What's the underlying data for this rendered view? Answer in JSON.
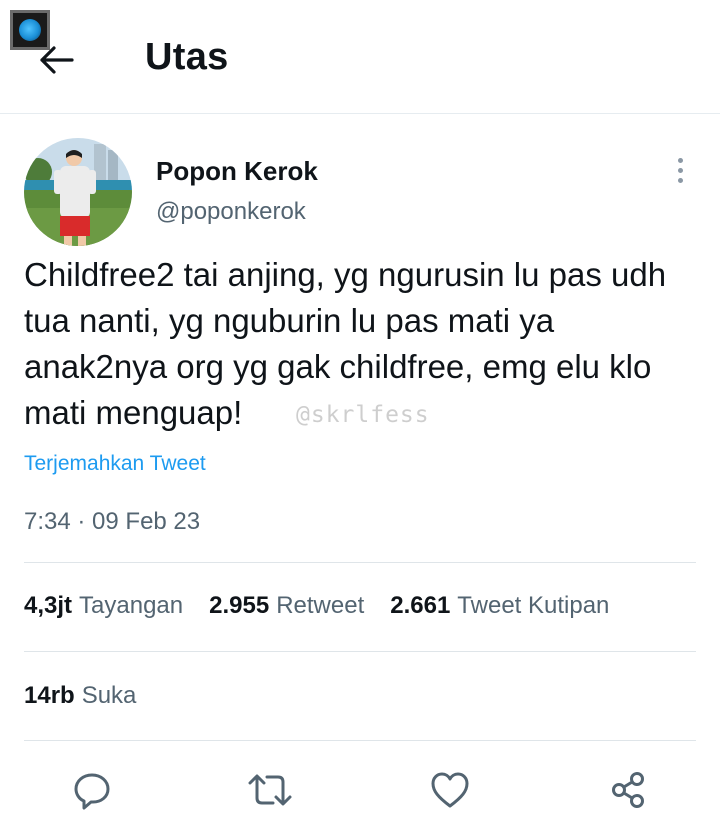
{
  "header": {
    "title": "Utas",
    "back_icon": "arrow-left-icon"
  },
  "tweet": {
    "author_name": "Popon Kerok",
    "author_handle": "@poponkerok",
    "text": "Childfree2 tai anjing, yg ngurusin lu pas udh tua nanti, yg nguburin lu pas mati ya anak2nya org yg gak childfree, emg elu klo mati menguap!",
    "watermark": "@skrlfess",
    "translate_label": "Terjemahkan Tweet",
    "timestamp": "7:34 · 09 Feb 23"
  },
  "stats": {
    "views_value": "4,3jt",
    "views_label": "Tayangan",
    "retweets_value": "2.955",
    "retweets_label": "Retweet",
    "quotes_value": "2.661",
    "quotes_label": "Tweet Kutipan",
    "likes_value": "14rb",
    "likes_label": "Suka"
  },
  "actions": [
    "reply-icon",
    "retweet-icon",
    "like-icon",
    "share-icon"
  ],
  "colors": {
    "link": "#1d9bf0",
    "secondary_text": "#536471",
    "primary_text": "#0f1419"
  }
}
